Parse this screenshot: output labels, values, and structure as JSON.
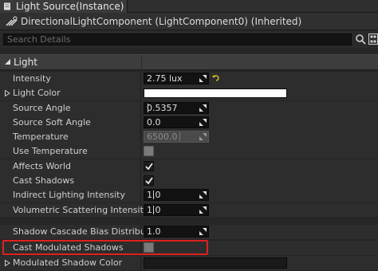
{
  "window": {
    "title": "Light Source(Instance)"
  },
  "component": {
    "label": "DirectionalLightComponent (LightComponent0) (Inherited)"
  },
  "search": {
    "placeholder": "Search Details"
  },
  "category": {
    "label": "Light"
  },
  "properties": {
    "intensity": {
      "label": "Intensity",
      "value": "2.75 lux"
    },
    "light_color": {
      "label": "Light Color",
      "color": "#ffffff"
    },
    "source_angle": {
      "label": "Source Angle",
      "value": "0.5357"
    },
    "source_soft_angle": {
      "label": "Source Soft Angle",
      "value": "0.0"
    },
    "temperature": {
      "label": "Temperature",
      "value": "6500.0"
    },
    "use_temperature": {
      "label": "Use Temperature",
      "checked": false,
      "disabled": true
    },
    "affects_world": {
      "label": "Affects World",
      "checked": true
    },
    "cast_shadows": {
      "label": "Cast Shadows",
      "checked": true
    },
    "indirect_lighting_intensity": {
      "label": "Indirect Lighting Intensity",
      "value": "1.0"
    },
    "volumetric_scattering_intensity": {
      "label": "Volumetric Scattering Intensity",
      "value": "1.0"
    },
    "shadow_cascade_bias_distribution": {
      "label": "Shadow Cascade Bias Distribution",
      "value": "1.0"
    },
    "cast_modulated_shadows": {
      "label": "Cast Modulated Shadows",
      "checked": false,
      "disabled": true
    },
    "modulated_shadow_color": {
      "label": "Modulated Shadow Color"
    }
  },
  "colors": {
    "highlight": "#e02020",
    "reset_arrow": "#d8c020"
  }
}
